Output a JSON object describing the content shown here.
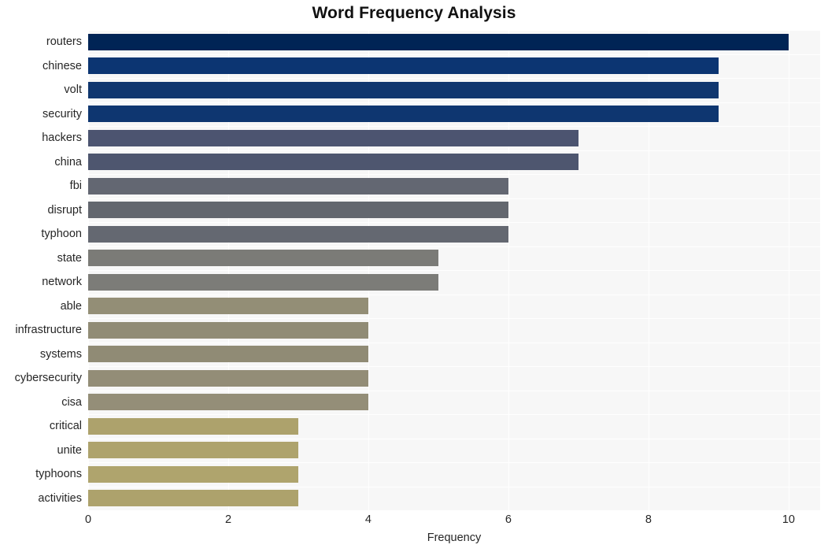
{
  "chart_data": {
    "type": "bar",
    "orientation": "horizontal",
    "title": "Word Frequency Analysis",
    "xlabel": "Frequency",
    "ylabel": "",
    "categories": [
      "routers",
      "chinese",
      "volt",
      "security",
      "hackers",
      "china",
      "fbi",
      "disrupt",
      "typhoon",
      "state",
      "network",
      "able",
      "infrastructure",
      "systems",
      "cybersecurity",
      "cisa",
      "critical",
      "unite",
      "typhoons",
      "activities"
    ],
    "values": [
      10,
      9,
      9,
      9,
      7,
      7,
      6,
      6,
      6,
      5,
      5,
      4,
      4,
      4,
      4,
      4,
      3,
      3,
      3,
      3
    ],
    "bar_colors": [
      "#002455",
      "#0c3572",
      "#10376f",
      "#0e3670",
      "#4c5470",
      "#4e566f",
      "#636772",
      "#63676f",
      "#646871",
      "#7b7b77",
      "#7c7c78",
      "#938e76",
      "#918c76",
      "#908b75",
      "#938d77",
      "#948e78",
      "#ada26c",
      "#aea36d",
      "#afa46d",
      "#ada26c"
    ],
    "xticks": [
      0,
      2,
      4,
      6,
      8,
      10
    ],
    "xlim": [
      0,
      10.45
    ],
    "grid": true,
    "grid_color": "#ffffff",
    "plot_background": "#f7f7f7",
    "figure_background": "#ffffff",
    "legend": null
  },
  "figure": {
    "title": "Word Frequency Analysis",
    "axis_label_x": "Frequency"
  }
}
